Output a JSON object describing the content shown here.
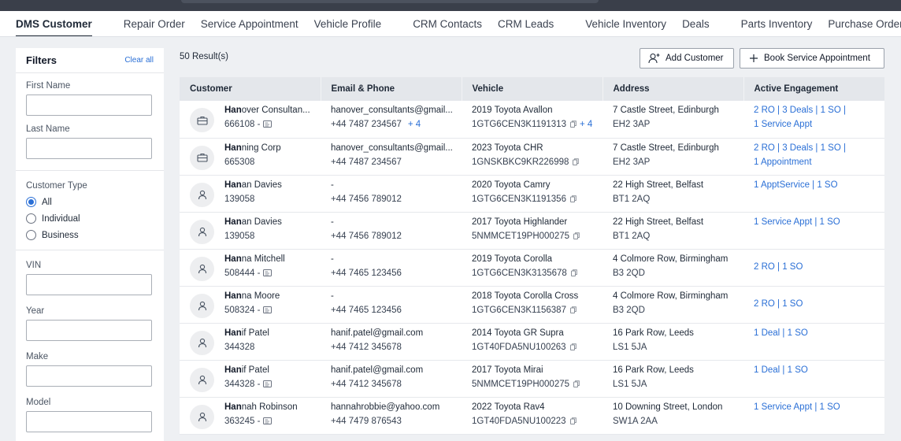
{
  "nav": {
    "tabs": [
      "DMS Customer",
      "Repair Order",
      "Service Appointment",
      "Vehicle Profile",
      "CRM Contacts",
      "CRM Leads",
      "Vehicle Inventory",
      "Deals",
      "Parts Inventory",
      "Purchase Order"
    ],
    "active": "DMS Customer"
  },
  "filters": {
    "title": "Filters",
    "clear": "Clear all",
    "first_name_label": "First Name",
    "last_name_label": "Last Name",
    "customer_type_label": "Customer Type",
    "customer_type_options": [
      "All",
      "Individual",
      "Business"
    ],
    "customer_type_selected": "All",
    "vin_label": "VIN",
    "year_label": "Year",
    "make_label": "Make",
    "model_label": "Model"
  },
  "toolbar": {
    "results": "50 Result(s)",
    "add_customer": "Add Customer",
    "book_service": "Book Service Appointment"
  },
  "table": {
    "columns": [
      "Customer",
      "Email & Phone",
      "Vehicle",
      "Address",
      "Active Engagement"
    ],
    "rows": [
      {
        "type": "business",
        "name_bold": "Han",
        "name_rest": "over Consultan...",
        "id": "666108 - ",
        "id_icon": true,
        "email": "hanover_consultants@gmail...",
        "phone": "+44 7487 234567",
        "phone_plus": "+ 4",
        "vehicle": "2019 Toyota Avallon",
        "vin": "1GTG6CEN3K1191313",
        "vin_plus": "+ 4",
        "addr1": "7 Castle Street, Edinburgh",
        "addr2": "EH2 3AP",
        "eng1": "2 RO | 3 Deals | 1 SO |",
        "eng2": "1 Service Appt"
      },
      {
        "type": "business",
        "name_bold": "Han",
        "name_rest": "ning Corp",
        "id": "665308",
        "id_icon": false,
        "email": "hanover_consultants@gmail...",
        "phone": "+44 7487 234567",
        "phone_plus": "",
        "vehicle": "2023 Toyota CHR",
        "vin": "1GNSKBKC9KR226998",
        "vin_plus": "",
        "addr1": "7 Castle Street, Edinburgh",
        "addr2": "EH2 3AP",
        "eng1": "2 RO | 3 Deals | 1 SO |",
        "eng2": "1 Appointment"
      },
      {
        "type": "person",
        "name_bold": "Han",
        "name_rest": "an Davies",
        "id": "139058",
        "id_icon": false,
        "email": "-",
        "phone": "+44 7456 789012",
        "phone_plus": "",
        "vehicle": "2020 Toyota Camry",
        "vin": "1GTG6CEN3K1191356",
        "vin_plus": "",
        "addr1": "22 High Street, Belfast",
        "addr2": "BT1 2AQ",
        "eng1": "1 ApptService | 1 SO",
        "eng2": ""
      },
      {
        "type": "person",
        "name_bold": "Han",
        "name_rest": "an Davies",
        "id": "139058",
        "id_icon": false,
        "email": "-",
        "phone": "+44 7456 789012",
        "phone_plus": "",
        "vehicle": "2017 Toyota Highlander",
        "vin": "5NMMCET19PH000275",
        "vin_plus": "",
        "addr1": "22 High Street, Belfast",
        "addr2": "BT1 2AQ",
        "eng1": "1 Service Appt | 1 SO",
        "eng2": ""
      },
      {
        "type": "person",
        "name_bold": "Han",
        "name_rest": "na Mitchell",
        "id": "508444 - ",
        "id_icon": true,
        "email": "-",
        "phone": "+44 7465 123456",
        "phone_plus": "",
        "vehicle": "2019 Toyota Corolla",
        "vin": "1GTG6CEN3K3135678",
        "vin_plus": "",
        "addr1": "4 Colmore Row, Birmingham",
        "addr2": "B3 2QD",
        "eng1": "2 RO | 1 SO",
        "eng2": "",
        "eng_mid": true
      },
      {
        "type": "person",
        "name_bold": "Han",
        "name_rest": "na Moore",
        "id": "508324 - ",
        "id_icon": true,
        "email": "-",
        "phone": "+44 7465 123456",
        "phone_plus": "",
        "vehicle": "2018 Toyota Corolla Cross",
        "vin": "1GTG6CEN3K1156387",
        "vin_plus": "",
        "addr1": "4 Colmore Row, Birmingham",
        "addr2": "B3 2QD",
        "eng1": "2 RO | 1 SO",
        "eng2": "",
        "eng_mid": true
      },
      {
        "type": "person",
        "name_bold": "Han",
        "name_rest": "if Patel",
        "id": "344328",
        "id_icon": false,
        "email": "hanif.patel@gmail.com",
        "phone": "+44 7412 345678",
        "phone_plus": "",
        "vehicle": "2014 Toyota GR Supra",
        "vin": "1GT40FDA5NU100263",
        "vin_plus": "",
        "addr1": "16 Park Row, Leeds",
        "addr2": "LS1 5JA",
        "eng1": "1 Deal | 1 SO",
        "eng2": ""
      },
      {
        "type": "person",
        "name_bold": "Han",
        "name_rest": "if Patel",
        "id": "344328 - ",
        "id_icon": true,
        "email": "hanif.patel@gmail.com",
        "phone": "+44 7412 345678",
        "phone_plus": "",
        "vehicle": "2017 Toyota Mirai",
        "vin": "5NMMCET19PH000275",
        "vin_plus": "",
        "addr1": "16 Park Row, Leeds",
        "addr2": "LS1 5JA",
        "eng1": "1 Deal | 1 SO",
        "eng2": ""
      },
      {
        "type": "person",
        "name_bold": "Han",
        "name_rest": "nah Robinson",
        "id": "363245 - ",
        "id_icon": true,
        "email": "hannahrobbie@yahoo.com",
        "phone": "+44 7479 876543",
        "phone_plus": "",
        "vehicle": "2022 Toyota Rav4",
        "vin": "1GT40FDA5NU100223",
        "vin_plus": "",
        "addr1": "10 Downing Street, London",
        "addr2": "SW1A 2AA",
        "eng1": "1 Service Appt | 1 SO",
        "eng2": ""
      }
    ]
  }
}
